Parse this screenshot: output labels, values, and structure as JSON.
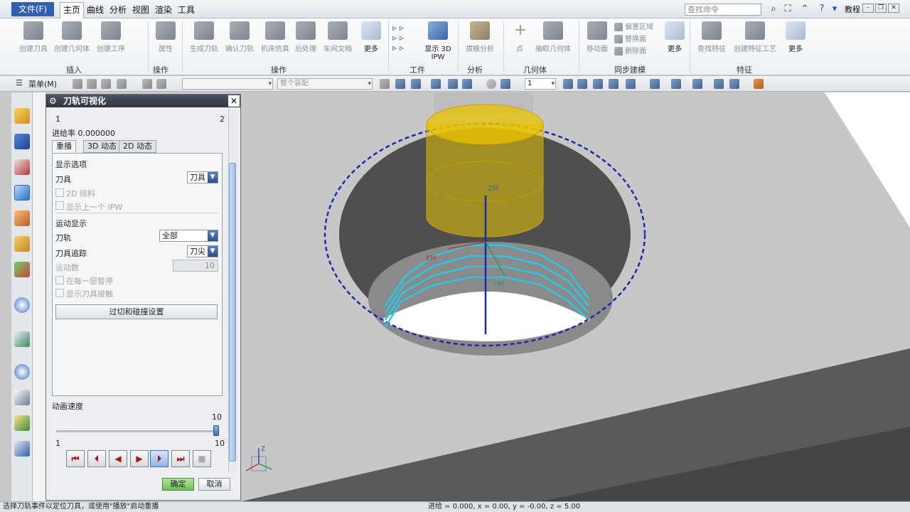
{
  "menubar": {
    "file": "文件(F)",
    "tabs": [
      "主页",
      "曲线",
      "分析",
      "视图",
      "渲染",
      "工具"
    ],
    "search_placeholder": "查找命令",
    "help_label": "教程"
  },
  "ribbon": {
    "buttons": [
      "创建刀具",
      "创建几何体",
      "创建工序",
      "属性",
      "生成刀轨",
      "确认刀轨",
      "机床仿真",
      "后处理",
      "车间文档",
      "更多",
      "显示 3D",
      "IPW",
      "拔模分析",
      "点",
      "抽取几何体",
      "移动面",
      "更多",
      "查找特征",
      "创建特征工艺",
      "更多"
    ],
    "small_buttons": [
      "偏置区域",
      "替换面",
      "删除面"
    ],
    "groups": [
      "插入",
      "操作",
      "操作",
      "工件",
      "分析",
      "几何体",
      "同步建模",
      "特征"
    ]
  },
  "toolbar": {
    "menu_label": "菜单(M)",
    "selection_filter": "整个装配",
    "layer_value": "1"
  },
  "dialog": {
    "title": "刀轨可视化",
    "list_left": "1",
    "list_right": "2",
    "feed_rate": "进给率 0.000000",
    "tabs": [
      "重播",
      "3D 动态",
      "2D 动态"
    ],
    "display_options": "显示选项",
    "tool_label": "刀具",
    "tool_value": "刀具",
    "opt_2d": "2D 除料",
    "opt_prev_ipw": "显示上一个 IPW",
    "motion_display": "运动显示",
    "path_label": "刀轨",
    "path_value": "全部",
    "trace_label": "刀具追踪",
    "trace_value": "刀尖",
    "motion_count_label": "运动数",
    "motion_count_value": "10",
    "pause_each_layer": "在每一层暂停",
    "show_tool_contact": "显示刀具接触",
    "gouge_button": "过切和碰撞设置",
    "anim_speed": "动画速度",
    "speed_max_label": "10",
    "speed_min": "1",
    "speed_max": "10",
    "speed_value": 10,
    "ok": "确定",
    "cancel": "取消"
  },
  "viewport": {
    "axis_zm": "ZM",
    "axis_ym": "YM",
    "axis_xm": "XM",
    "triad_z": "Z",
    "tool_color": "#e8c300",
    "path_color": "#29c6e6",
    "boundary_color": "#1b2aa8"
  },
  "status": {
    "left": "选择刀轨事件以定位刀具，或使用\"播放\"启动重播",
    "right": "进给 = 0.000, x = 0.00, y = -0.00, z = 5.00"
  }
}
